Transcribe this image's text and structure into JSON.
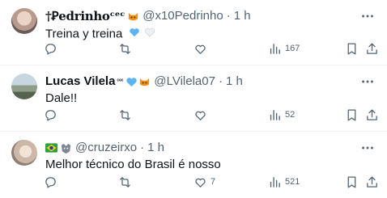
{
  "replies": [
    {
      "name": "†Ꝑedrinhoᶜᵉᶜ",
      "handle": "@x10Pedrinho",
      "dot": "·",
      "time": "1 h",
      "text": "Treina y treina",
      "heart_icons": [
        "blue-heart-icon",
        "white-heart-icon"
      ],
      "badges": [
        "cat-emoji-icon"
      ],
      "stats": {
        "replies": "",
        "retweets": "",
        "likes": "",
        "views": "167"
      }
    },
    {
      "name": "Lucas Vilela",
      "sup": "ᶜᵉᶜ",
      "handle": "@LVilela07",
      "dot": "·",
      "time": "1 h",
      "text": "Dale!!",
      "badges": [
        "blue-heart-icon",
        "cat-emoji-icon"
      ],
      "stats": {
        "replies": "",
        "retweets": "",
        "likes": "",
        "views": "52"
      }
    },
    {
      "name": "",
      "handle": "@cruzeirxo",
      "dot": "·",
      "time": "1 h",
      "text": "Melhor técnico do Brasil é nosso",
      "badges": [
        "brazil-flag-icon",
        "fox-crest-icon"
      ],
      "stats": {
        "replies": "",
        "retweets": "",
        "likes": "7",
        "views": "521"
      }
    }
  ],
  "colors": {
    "text": "#0f1419",
    "muted": "#536471",
    "divider": "#eff3f4",
    "blue_heart": "#5db3f0"
  }
}
